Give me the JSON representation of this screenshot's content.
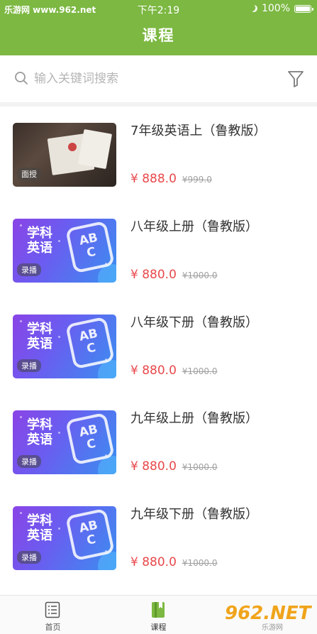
{
  "status_bar": {
    "carrier": "乐游网 www.962.net",
    "time": "下午2:19",
    "battery": "100%"
  },
  "header": {
    "title": "课程"
  },
  "search": {
    "placeholder": "输入关键词搜索"
  },
  "courses": [
    {
      "title": "7年级英语上（鲁教版）",
      "price": "¥ 888.0",
      "original_price": "¥999.0",
      "badge": "面授",
      "thumbnail": "photo"
    },
    {
      "title": "八年级上册（鲁教版）",
      "price": "¥ 880.0",
      "original_price": "¥1000.0",
      "badge": "录播",
      "thumbnail": "subject-english",
      "subject_text": "学科英语",
      "abc": "ABC"
    },
    {
      "title": "八年级下册（鲁教版）",
      "price": "¥ 880.0",
      "original_price": "¥1000.0",
      "badge": "录播",
      "thumbnail": "subject-english",
      "subject_text": "学科英语",
      "abc": "ABC"
    },
    {
      "title": "九年级上册（鲁教版）",
      "price": "¥ 880.0",
      "original_price": "¥1000.0",
      "badge": "录播",
      "thumbnail": "subject-english",
      "subject_text": "学科英语",
      "abc": "ABC"
    },
    {
      "title": "九年级下册（鲁教版）",
      "price": "¥ 880.0",
      "original_price": "¥1000.0",
      "badge": "录播",
      "thumbnail": "subject-english",
      "subject_text": "学科英语",
      "abc": "ABC"
    }
  ],
  "tabbar": {
    "tabs": [
      {
        "label": "首页",
        "icon": "list-icon"
      },
      {
        "label": "课程",
        "icon": "book-icon",
        "active": true
      },
      {
        "label": "",
        "icon": ""
      }
    ]
  },
  "watermark": {
    "text": "962.NET",
    "sub": "乐游网"
  },
  "colors": {
    "brand_green": "#7cb842",
    "price_red": "#e8484b"
  }
}
